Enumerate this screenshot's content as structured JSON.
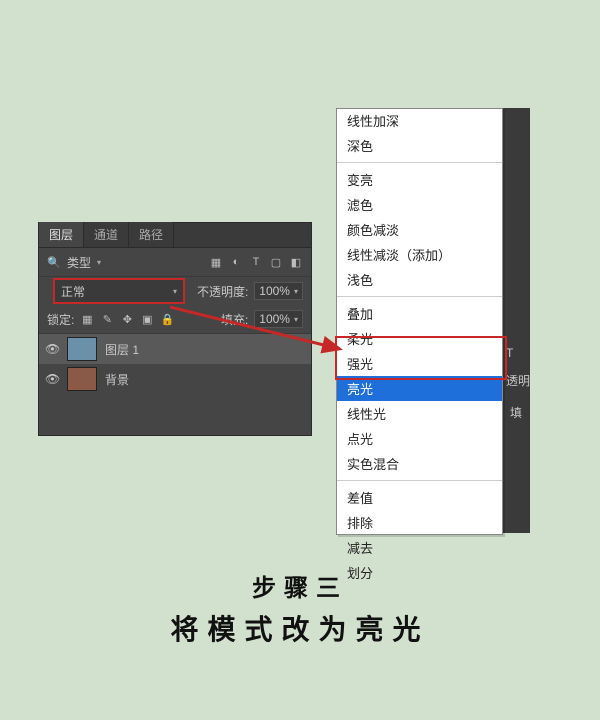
{
  "caption": {
    "line1": "步骤三",
    "line2": "将模式改为亮光"
  },
  "layers_panel": {
    "tabs": {
      "layers": "图层",
      "channels": "通道",
      "paths": "路径"
    },
    "filter_label": "类型",
    "blend_mode": "正常",
    "opacity_label": "不透明度:",
    "opacity_value": "100%",
    "lock_label": "锁定:",
    "fill_label": "填充:",
    "fill_value": "100%",
    "layers": [
      {
        "name": "图层 1",
        "visible": true,
        "selected": true
      },
      {
        "name": "背景",
        "visible": true,
        "selected": false
      }
    ]
  },
  "blend_menu": {
    "selected": "亮光",
    "groups": [
      [
        "线性加深",
        "深色"
      ],
      [
        "变亮",
        "滤色",
        "颜色减淡",
        "线性减淡（添加）",
        "浅色"
      ],
      [
        "叠加",
        "柔光",
        "强光",
        "亮光",
        "线性光",
        "点光",
        "实色混合"
      ],
      [
        "差值",
        "排除",
        "减去",
        "划分"
      ]
    ]
  },
  "side": {
    "opacity_short": "透明",
    "fill_short": "填"
  },
  "glyphs": {
    "search": "🔍",
    "chevron": "▾",
    "eye": "👁",
    "img": "▦",
    "circle": "◐",
    "text": "T",
    "rect": "▢",
    "square": "◧"
  },
  "colors": {
    "highlight": "#c62828",
    "menu_selected": "#1e6fd9"
  }
}
